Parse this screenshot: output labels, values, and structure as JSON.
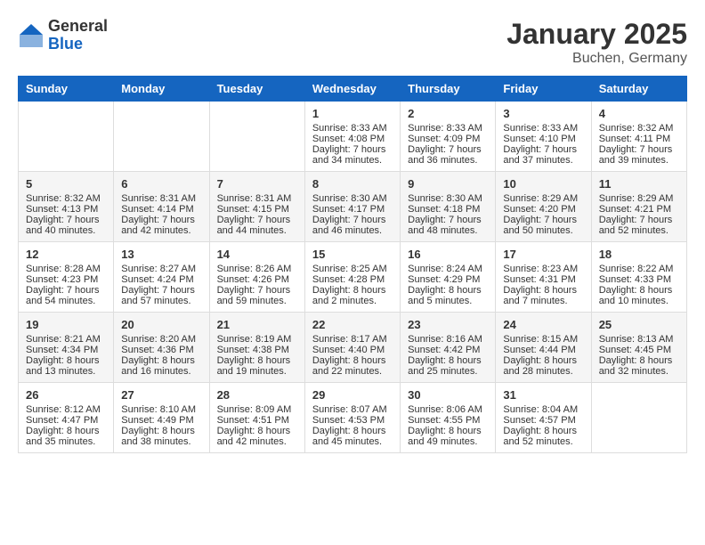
{
  "logo": {
    "general": "General",
    "blue": "Blue"
  },
  "title": "January 2025",
  "subtitle": "Buchen, Germany",
  "days_of_week": [
    "Sunday",
    "Monday",
    "Tuesday",
    "Wednesday",
    "Thursday",
    "Friday",
    "Saturday"
  ],
  "weeks": [
    [
      {
        "day": "",
        "content": ""
      },
      {
        "day": "",
        "content": ""
      },
      {
        "day": "",
        "content": ""
      },
      {
        "day": "1",
        "sunrise": "Sunrise: 8:33 AM",
        "sunset": "Sunset: 4:08 PM",
        "daylight": "Daylight: 7 hours and 34 minutes."
      },
      {
        "day": "2",
        "sunrise": "Sunrise: 8:33 AM",
        "sunset": "Sunset: 4:09 PM",
        "daylight": "Daylight: 7 hours and 36 minutes."
      },
      {
        "day": "3",
        "sunrise": "Sunrise: 8:33 AM",
        "sunset": "Sunset: 4:10 PM",
        "daylight": "Daylight: 7 hours and 37 minutes."
      },
      {
        "day": "4",
        "sunrise": "Sunrise: 8:32 AM",
        "sunset": "Sunset: 4:11 PM",
        "daylight": "Daylight: 7 hours and 39 minutes."
      }
    ],
    [
      {
        "day": "5",
        "sunrise": "Sunrise: 8:32 AM",
        "sunset": "Sunset: 4:13 PM",
        "daylight": "Daylight: 7 hours and 40 minutes."
      },
      {
        "day": "6",
        "sunrise": "Sunrise: 8:31 AM",
        "sunset": "Sunset: 4:14 PM",
        "daylight": "Daylight: 7 hours and 42 minutes."
      },
      {
        "day": "7",
        "sunrise": "Sunrise: 8:31 AM",
        "sunset": "Sunset: 4:15 PM",
        "daylight": "Daylight: 7 hours and 44 minutes."
      },
      {
        "day": "8",
        "sunrise": "Sunrise: 8:30 AM",
        "sunset": "Sunset: 4:17 PM",
        "daylight": "Daylight: 7 hours and 46 minutes."
      },
      {
        "day": "9",
        "sunrise": "Sunrise: 8:30 AM",
        "sunset": "Sunset: 4:18 PM",
        "daylight": "Daylight: 7 hours and 48 minutes."
      },
      {
        "day": "10",
        "sunrise": "Sunrise: 8:29 AM",
        "sunset": "Sunset: 4:20 PM",
        "daylight": "Daylight: 7 hours and 50 minutes."
      },
      {
        "day": "11",
        "sunrise": "Sunrise: 8:29 AM",
        "sunset": "Sunset: 4:21 PM",
        "daylight": "Daylight: 7 hours and 52 minutes."
      }
    ],
    [
      {
        "day": "12",
        "sunrise": "Sunrise: 8:28 AM",
        "sunset": "Sunset: 4:23 PM",
        "daylight": "Daylight: 7 hours and 54 minutes."
      },
      {
        "day": "13",
        "sunrise": "Sunrise: 8:27 AM",
        "sunset": "Sunset: 4:24 PM",
        "daylight": "Daylight: 7 hours and 57 minutes."
      },
      {
        "day": "14",
        "sunrise": "Sunrise: 8:26 AM",
        "sunset": "Sunset: 4:26 PM",
        "daylight": "Daylight: 7 hours and 59 minutes."
      },
      {
        "day": "15",
        "sunrise": "Sunrise: 8:25 AM",
        "sunset": "Sunset: 4:28 PM",
        "daylight": "Daylight: 8 hours and 2 minutes."
      },
      {
        "day": "16",
        "sunrise": "Sunrise: 8:24 AM",
        "sunset": "Sunset: 4:29 PM",
        "daylight": "Daylight: 8 hours and 5 minutes."
      },
      {
        "day": "17",
        "sunrise": "Sunrise: 8:23 AM",
        "sunset": "Sunset: 4:31 PM",
        "daylight": "Daylight: 8 hours and 7 minutes."
      },
      {
        "day": "18",
        "sunrise": "Sunrise: 8:22 AM",
        "sunset": "Sunset: 4:33 PM",
        "daylight": "Daylight: 8 hours and 10 minutes."
      }
    ],
    [
      {
        "day": "19",
        "sunrise": "Sunrise: 8:21 AM",
        "sunset": "Sunset: 4:34 PM",
        "daylight": "Daylight: 8 hours and 13 minutes."
      },
      {
        "day": "20",
        "sunrise": "Sunrise: 8:20 AM",
        "sunset": "Sunset: 4:36 PM",
        "daylight": "Daylight: 8 hours and 16 minutes."
      },
      {
        "day": "21",
        "sunrise": "Sunrise: 8:19 AM",
        "sunset": "Sunset: 4:38 PM",
        "daylight": "Daylight: 8 hours and 19 minutes."
      },
      {
        "day": "22",
        "sunrise": "Sunrise: 8:17 AM",
        "sunset": "Sunset: 4:40 PM",
        "daylight": "Daylight: 8 hours and 22 minutes."
      },
      {
        "day": "23",
        "sunrise": "Sunrise: 8:16 AM",
        "sunset": "Sunset: 4:42 PM",
        "daylight": "Daylight: 8 hours and 25 minutes."
      },
      {
        "day": "24",
        "sunrise": "Sunrise: 8:15 AM",
        "sunset": "Sunset: 4:44 PM",
        "daylight": "Daylight: 8 hours and 28 minutes."
      },
      {
        "day": "25",
        "sunrise": "Sunrise: 8:13 AM",
        "sunset": "Sunset: 4:45 PM",
        "daylight": "Daylight: 8 hours and 32 minutes."
      }
    ],
    [
      {
        "day": "26",
        "sunrise": "Sunrise: 8:12 AM",
        "sunset": "Sunset: 4:47 PM",
        "daylight": "Daylight: 8 hours and 35 minutes."
      },
      {
        "day": "27",
        "sunrise": "Sunrise: 8:10 AM",
        "sunset": "Sunset: 4:49 PM",
        "daylight": "Daylight: 8 hours and 38 minutes."
      },
      {
        "day": "28",
        "sunrise": "Sunrise: 8:09 AM",
        "sunset": "Sunset: 4:51 PM",
        "daylight": "Daylight: 8 hours and 42 minutes."
      },
      {
        "day": "29",
        "sunrise": "Sunrise: 8:07 AM",
        "sunset": "Sunset: 4:53 PM",
        "daylight": "Daylight: 8 hours and 45 minutes."
      },
      {
        "day": "30",
        "sunrise": "Sunrise: 8:06 AM",
        "sunset": "Sunset: 4:55 PM",
        "daylight": "Daylight: 8 hours and 49 minutes."
      },
      {
        "day": "31",
        "sunrise": "Sunrise: 8:04 AM",
        "sunset": "Sunset: 4:57 PM",
        "daylight": "Daylight: 8 hours and 52 minutes."
      },
      {
        "day": "",
        "content": ""
      }
    ]
  ]
}
